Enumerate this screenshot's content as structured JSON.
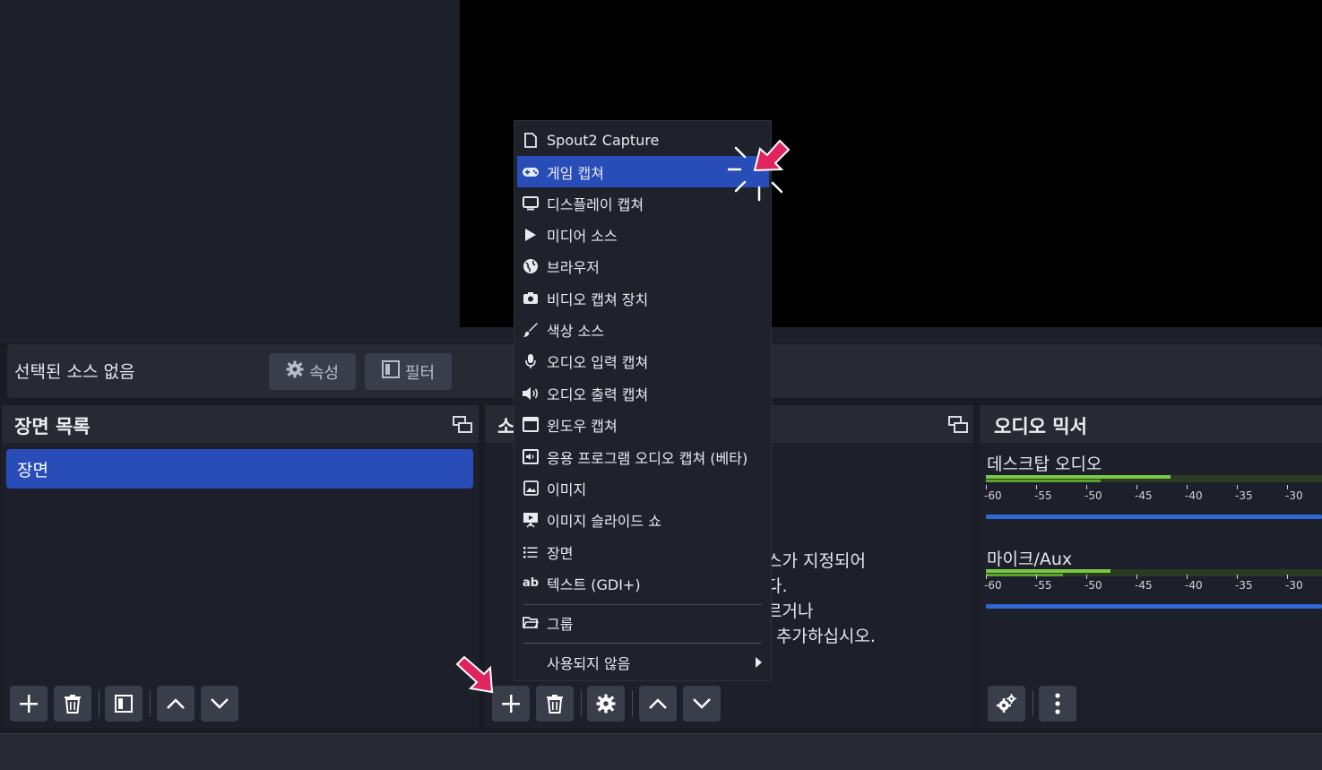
{
  "context_bar": {
    "no_source_label": "선택된 소스 없음",
    "properties_label": "속성",
    "filters_label": "필터"
  },
  "scenes": {
    "title": "장면 목록",
    "items": [
      "장면"
    ]
  },
  "sources": {
    "title_partial": "소",
    "hint_lines": [
      "스가 지정되어",
      "다.",
      "르거나",
      "추가하십시오."
    ]
  },
  "mixer": {
    "title": "오디오 믹서",
    "channels": [
      {
        "name": "데스크탑 오디오",
        "level": 0.55,
        "volume": 1.0
      },
      {
        "name": "마이크/Aux",
        "level": 0.37,
        "volume": 1.0
      }
    ],
    "ticks": [
      "-60",
      "-55",
      "-50",
      "-45",
      "-40",
      "-35",
      "-30"
    ]
  },
  "menu": {
    "items": [
      {
        "label": "Spout2 Capture",
        "icon": "file-icon"
      },
      {
        "label": "게임 캡쳐",
        "icon": "gamepad-icon",
        "active": true
      },
      {
        "label": "디스플레이 캡쳐",
        "icon": "monitor-icon"
      },
      {
        "label": "미디어 소스",
        "icon": "play-icon"
      },
      {
        "label": "브라우저",
        "icon": "globe-icon"
      },
      {
        "label": "비디오 캡쳐 장치",
        "icon": "camera-icon"
      },
      {
        "label": "색상 소스",
        "icon": "brush-icon"
      },
      {
        "label": "오디오 입력 캡쳐",
        "icon": "microphone-icon"
      },
      {
        "label": "오디오 출력 캡쳐",
        "icon": "speaker-icon"
      },
      {
        "label": "윈도우 캡쳐",
        "icon": "window-icon"
      },
      {
        "label": "응용 프로그램 오디오 캡쳐 (베타)",
        "icon": "app-audio-icon"
      },
      {
        "label": "이미지",
        "icon": "image-icon"
      },
      {
        "label": "이미지 슬라이드 쇼",
        "icon": "slideshow-icon"
      },
      {
        "label": "장면",
        "icon": "list-icon"
      },
      {
        "label": "텍스트 (GDI+)",
        "icon": "text-icon"
      },
      {
        "label": "그룹",
        "icon": "folder-icon"
      },
      {
        "label": "사용되지 않음",
        "icon": "",
        "submenu": true
      }
    ]
  },
  "colors": {
    "accent": "#284cb8",
    "callout": "#e0245e",
    "meter_green": "#7ac943",
    "volume_blue": "#2e6ad6"
  }
}
